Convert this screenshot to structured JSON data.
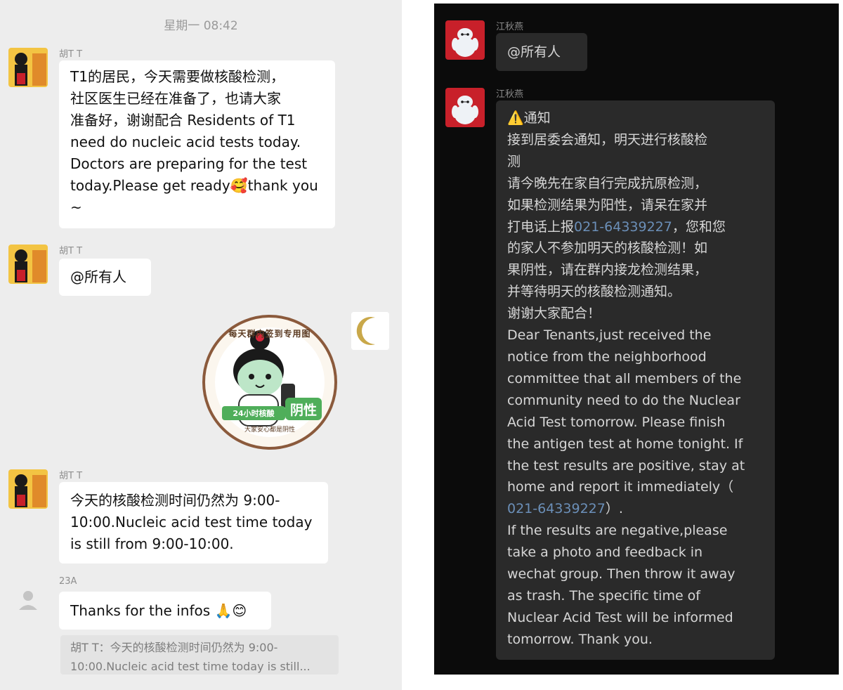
{
  "left_chat": {
    "timestamp": "星期一 08:42",
    "messages": [
      {
        "sender": "胡T T",
        "text": "T1的居民，今天需要做核酸检测，\n社区医生已经在准备了，也请大家\n准备好，谢谢配合 Residents of T1\nneed do nucleic acid tests today.\nDoctors are preparing for the test\ntoday.Please get ready🥰thank you\n~"
      },
      {
        "sender": "胡T T",
        "text": "@所有人"
      },
      {
        "sticker_text_top": "每天群内签到专用图",
        "sticker_text_badge": "24小时核酸",
        "sticker_text_status": "阴性",
        "sticker_text_bottom": "大家安心都是阴性"
      },
      {
        "sender": "胡T T",
        "text": "今天的核酸检测时间仍然为 9:00-\n10:00.Nucleic acid test time today\nis still from 9:00-10:00."
      },
      {
        "sender": "23A",
        "text": "Thanks for the infos 🙏😊",
        "quote": "胡T T：今天的核酸检测时间仍然为 9:00-\n10:00.Nucleic acid test time today is still..."
      }
    ]
  },
  "right_chat": {
    "messages": [
      {
        "sender": "江秋燕",
        "text": "@所有人"
      },
      {
        "sender": "江秋燕",
        "lines": [
          "⚠️通知",
          "接到居委会通知，明天进行核酸检",
          "测",
          "请今晚先在家自行完成抗原检测，",
          "如果检测结果为阳性，请呆在家并",
          "打电话上报",
          "021-64339227",
          "，您和您",
          "的家人不参加明天的核酸检测！如",
          "果阴性，请在群内接龙检测结果，",
          "并等待明天的核酸检测通知。",
          "谢谢大家配合！",
          "Dear Tenants,just received the",
          "notice from the neighborhood",
          "committee that all members of the",
          "community need to do the Nuclear",
          "Acid Test tomorrow. Please finish",
          "the antigen test at home tonight. If",
          "the test results are positive, stay at",
          "home and report it immediately（",
          "021-64339227",
          "）.",
          "If the results are negative,please",
          "take a photo and feedback in",
          "wechat group. Then throw it away",
          "as trash. The specific time of",
          "Nuclear Acid Test will be informed",
          "tomorrow. Thank you."
        ]
      }
    ]
  },
  "colors": {
    "left_bg": "#ededed",
    "right_bg": "#0b0b0b",
    "bubble_light": "#ffffff",
    "bubble_dark": "#2a2a2a",
    "link": "#6b8fb8",
    "avatar_red": "#c8202a",
    "sticker_green": "#4fae5a",
    "sticker_ring": "#8b5a3c"
  }
}
